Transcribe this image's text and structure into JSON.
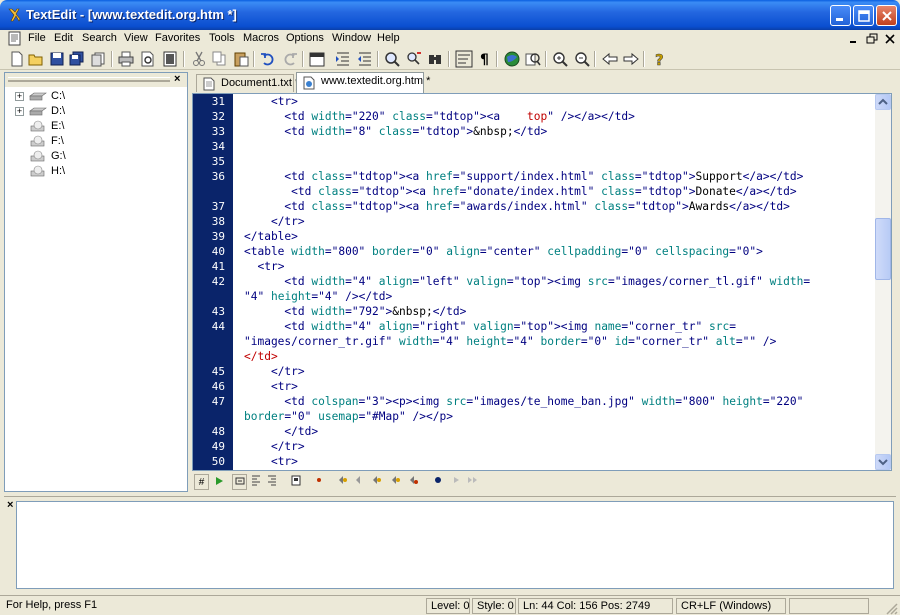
{
  "window": {
    "title": "TextEdit - [www.textedit.org.htm *]"
  },
  "menu": [
    "File",
    "Edit",
    "Search",
    "View",
    "Favorites",
    "Tools",
    "Macros",
    "Options",
    "Window",
    "Help"
  ],
  "toolbar_icons": [
    "new-icon",
    "open-icon",
    "save-icon",
    "save-all-icon",
    "copy-file-icon",
    "print-icon",
    "print-preview-icon",
    "page-setup-icon",
    "cut-icon",
    "copy-icon",
    "paste-icon",
    "undo-icon",
    "redo-icon",
    "calendar-icon",
    "indent-icon",
    "outdent-icon",
    "find-icon",
    "replace-icon",
    "find-in-files-icon",
    "wrap-icon",
    "pilcrow-icon",
    "browser-icon",
    "search-web-icon",
    "zoom-in-icon",
    "zoom-out-icon",
    "back-icon",
    "forward-icon",
    "help-icon"
  ],
  "explorer": {
    "drives": [
      {
        "label": "C:\\",
        "expandable": true
      },
      {
        "label": "D:\\",
        "expandable": true
      },
      {
        "label": "E:\\",
        "expandable": false
      },
      {
        "label": "F:\\",
        "expandable": false
      },
      {
        "label": "G:\\",
        "expandable": false
      },
      {
        "label": "H:\\",
        "expandable": false
      }
    ]
  },
  "tabs": [
    {
      "label": "Document1.txt *",
      "active": false
    },
    {
      "label": "www.textedit.org.htm *",
      "active": true
    }
  ],
  "editor": {
    "lines": [
      {
        "n": "31",
        "text": "    <tr>"
      },
      {
        "n": "32",
        "text": "      <td width=\"220\" class=\"tdtop\"><a    top\" /></a></td>"
      },
      {
        "n": "33",
        "text": "      <td width=\"8\" class=\"tdtop\">&nbsp;</td>"
      },
      {
        "n": "34",
        "text": ""
      },
      {
        "n": "35",
        "text": ""
      },
      {
        "n": "36",
        "text": "      <td class=\"tdtop\"><a href=\"support/index.html\" class=\"tdtop\">Support</a></td>"
      },
      {
        "n": "",
        "text": "       <td class=\"tdtop\"><a href=\"donate/index.html\" class=\"tdtop\">Donate</a></td>"
      },
      {
        "n": "37",
        "text": "      <td class=\"tdtop\"><a href=\"awards/index.html\" class=\"tdtop\">Awards</a></td>"
      },
      {
        "n": "38",
        "text": "    </tr>"
      },
      {
        "n": "39",
        "text": "</table>"
      },
      {
        "n": "40",
        "text": "<table width=\"800\" border=\"0\" align=\"center\" cellpadding=\"0\" cellspacing=\"0\">"
      },
      {
        "n": "41",
        "text": "  <tr>"
      },
      {
        "n": "42",
        "text": "      <td width=\"4\" align=\"left\" valign=\"top\"><img src=\"images/corner_tl.gif\" width="
      },
      {
        "n": "",
        "text": "\"4\" height=\"4\" /></td>"
      },
      {
        "n": "43",
        "text": "      <td width=\"792\">&nbsp;</td>"
      },
      {
        "n": "44",
        "text": "      <td width=\"4\" align=\"right\" valign=\"top\"><img name=\"corner_tr\" src="
      },
      {
        "n": "",
        "text": "\"images/corner_tr.gif\" width=\"4\" height=\"4\" border=\"0\" id=\"corner_tr\" alt=\"\" />"
      },
      {
        "n": "",
        "text": "</td>"
      },
      {
        "n": "45",
        "text": "    </tr>"
      },
      {
        "n": "46",
        "text": "    <tr>"
      },
      {
        "n": "47",
        "text": "      <td colspan=\"3\"><p><img src=\"images/te_home_ban.jpg\" width=\"800\" height=\"220\""
      },
      {
        "n": "",
        "text": "border=\"0\" usemap=\"#Map\" /></p>"
      },
      {
        "n": "48",
        "text": "      </td>"
      },
      {
        "n": "49",
        "text": "    </tr>"
      },
      {
        "n": "50",
        "text": "    <tr>"
      }
    ]
  },
  "bottom_toolbar_label": "#",
  "status": {
    "help": "For Help, press F1",
    "level": "Level: 0",
    "style": "Style: 0",
    "position": "Ln: 44 Col: 156 Pos: 2749",
    "line_ending": "CR+LF (Windows)"
  }
}
